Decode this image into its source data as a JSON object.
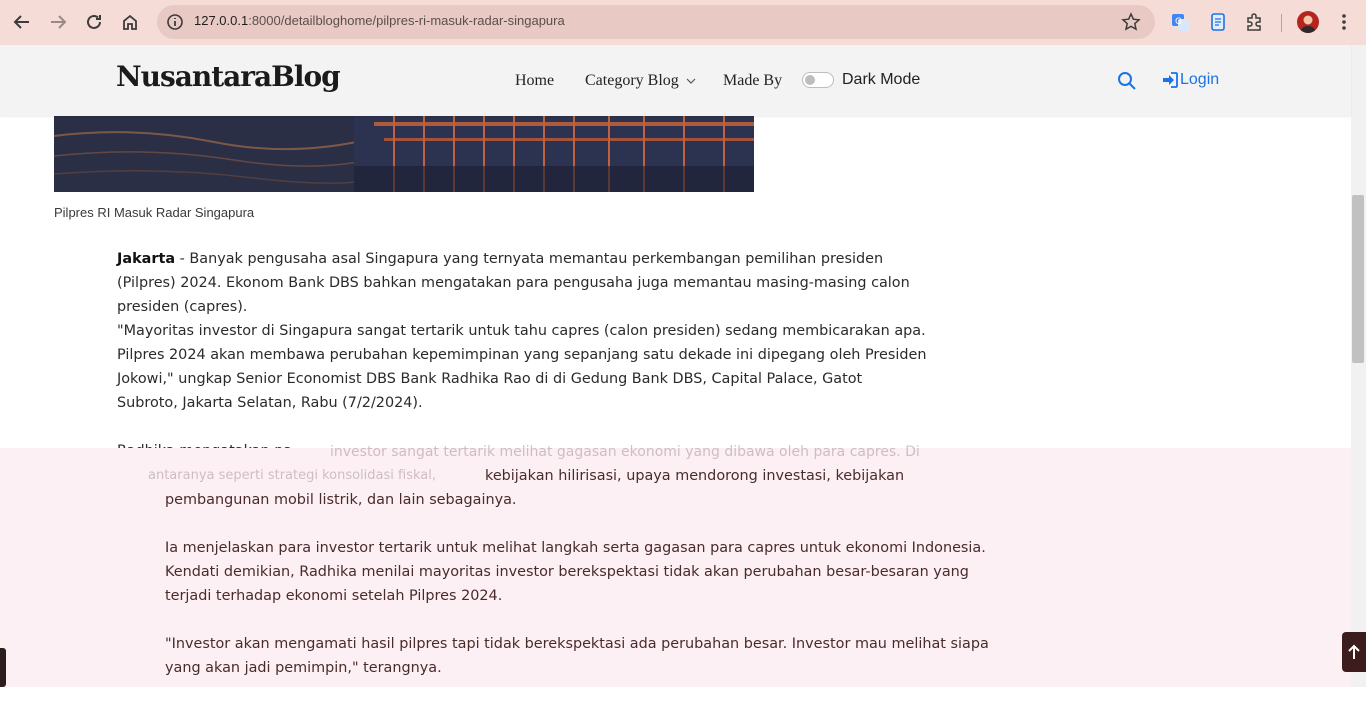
{
  "browser": {
    "url_host": "127.0.0.1",
    "url_rest": ":8000/detailbloghome/pilpres-ri-masuk-radar-singapura"
  },
  "navbar": {
    "brand": "NusantaraBlog",
    "links": [
      "Home",
      "Category Blog",
      "Made By"
    ],
    "dark_mode_label": "Dark Mode",
    "login_label": "Login"
  },
  "article": {
    "image_caption": "Pilpres RI Masuk Radar Singapura",
    "dateline": "Jakarta",
    "p1_rest": " - Banyak pengusaha asal Singapura yang ternyata memantau perkembangan pemilihan presiden (Pilpres) 2024. Ekonom Bank DBS bahkan mengatakan para pengusaha juga memantau masing-masing calon presiden (capres).",
    "p1_quote": "\"Mayoritas investor di Singapura sangat tertarik untuk tahu capres (calon presiden) sedang membicarakan apa. Pilpres 2024 akan membawa perubahan kepemimpinan yang sepanjang satu dekade ini dipegang oleh Presiden Jokowi,\" ungkap Senior Economist DBS Bank Radhika Rao di di Gedung Bank DBS, Capital Palace, Gatot Subroto, Jakarta Selatan, Rabu (7/2/2024).",
    "p2_start": "Radhika mengatakan pa",
    "ghost_line": "investor sangat tertarik melihat gagasan ekonomi yang dibawa oleh para capres. Di",
    "ghost_line2": "antaranya seperti strategi konsolidasi fiskal,",
    "p2_cont": "kebijakan hilirisasi, upaya mendorong investasi, kebijakan pembangunan mobil listrik, dan lain sebagainya.",
    "p3": "Ia menjelaskan para investor tertarik untuk melihat langkah serta gagasan para capres untuk ekonomi Indonesia. Kendati demikian, Radhika menilai mayoritas investor berekspektasi tidak akan perubahan besar-besaran yang terjadi terhadap ekonomi setelah Pilpres 2024.",
    "p4": "\"Investor akan mengamati hasil pilpres tapi tidak berekspektasi ada perubahan besar. Investor mau melihat siapa yang akan jadi pemimpin,\" terangnya."
  },
  "colors": {
    "chrome_bg": "#f6dcd7",
    "navbar_bg": "#f3f3f3",
    "login_blue": "#1a73e8",
    "overlay_pink": "#fdf0f5"
  },
  "icons": [
    "back-icon",
    "forward-icon",
    "reload-icon",
    "home-icon",
    "site-info-icon",
    "bookmark-star-icon",
    "translate-icon",
    "reader-icon",
    "extensions-icon",
    "menu-dots-icon",
    "chevron-down-icon",
    "search-icon",
    "login-icon",
    "arrow-up-icon"
  ]
}
